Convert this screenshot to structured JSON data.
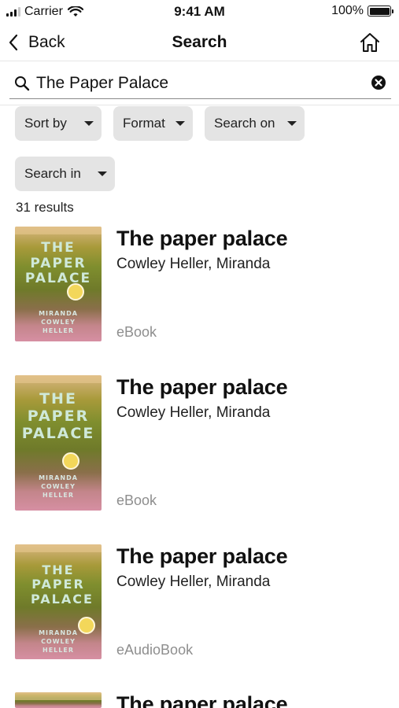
{
  "status_bar": {
    "carrier": "Carrier",
    "time": "9:41 AM",
    "battery": "100%"
  },
  "nav": {
    "back_label": "Back",
    "title": "Search",
    "home_icon": "home-icon"
  },
  "search": {
    "value": "The Paper Palace",
    "icon": "search-icon",
    "clear_icon": "clear-icon"
  },
  "filters": {
    "sort_by": "Sort by",
    "format": "Format",
    "search_on": "Search on",
    "search_in": "Search in"
  },
  "results_count": "31 results",
  "results": [
    {
      "title": "The paper palace",
      "author": "Cowley Heller, Miranda",
      "format": "eBook",
      "cover_title": "THE PAPER PALACE",
      "cover_author": "MIRANDA COWLEY HELLER"
    },
    {
      "title": "The paper palace",
      "author": "Cowley Heller, Miranda",
      "format": "eBook",
      "cover_title": "THE PAPER PALACE",
      "cover_author": "MIRANDA COWLEY HELLER"
    },
    {
      "title": "The paper palace",
      "author": "Cowley Heller, Miranda",
      "format": "eAudioBook",
      "cover_title": "THE PAPER PALACE",
      "cover_author": "MIRANDA COWLEY HELLER"
    },
    {
      "title": "The paper palace"
    }
  ],
  "colors": {
    "chip_background": "#e4e4e4",
    "format_text": "#8e8e8e",
    "cover_title_text": "#cfe9d9"
  }
}
